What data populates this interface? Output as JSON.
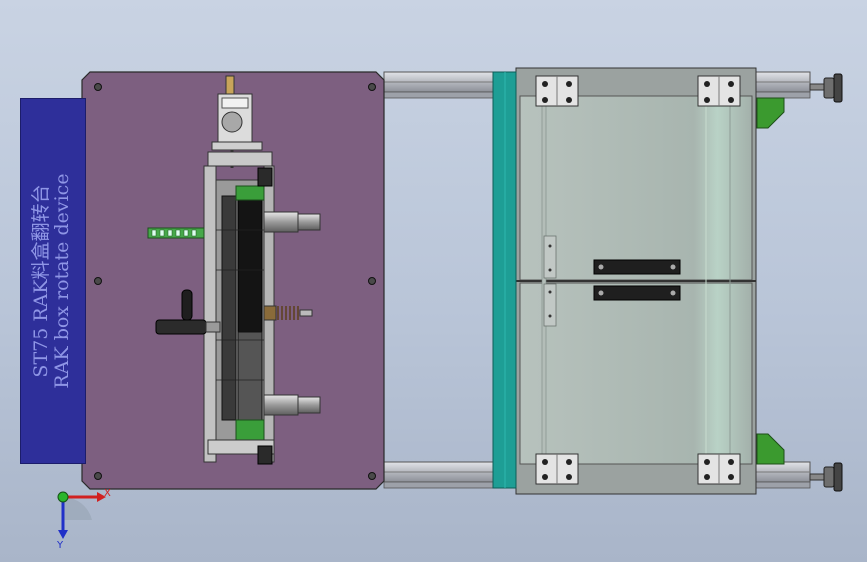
{
  "sign": {
    "line1": "ST75  RAK料盒翻转台",
    "line2": "RAK box rotate device"
  },
  "triad": {
    "x_label": "X",
    "y_label": "Y"
  },
  "colors": {
    "background": "#c3cde0",
    "plate": "#7d5f80",
    "sign": "#2e2f9a",
    "rail": "#b9bcc2",
    "teal_bar": "#1e9e95",
    "glass": "#a9b6b0",
    "bracket_green": "#3b9a2f"
  }
}
